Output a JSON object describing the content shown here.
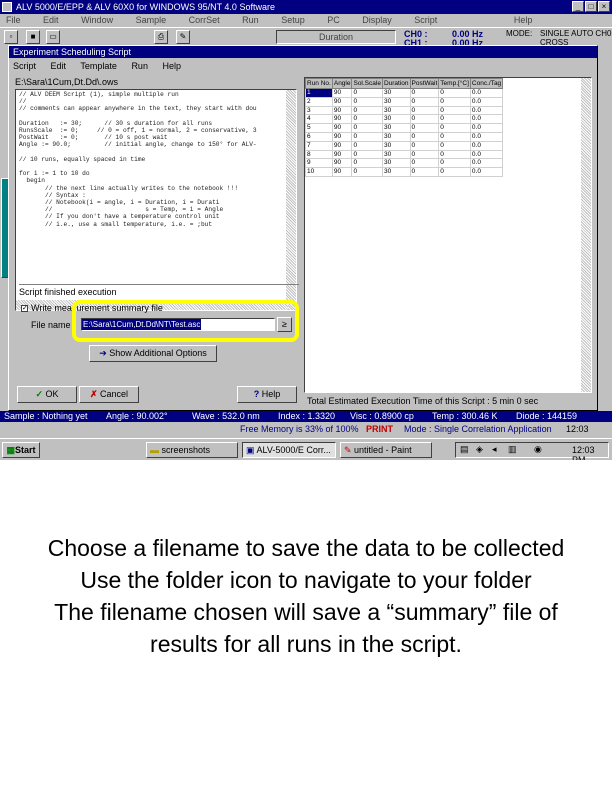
{
  "app": {
    "title": "ALV 5000/E/EPP & ALV 60X0 for WINDOWS 95/NT 4.0 Software",
    "menu": [
      "File",
      "Edit",
      "Window",
      "Sample",
      "CorrSet",
      "Run",
      "Setup",
      "PC",
      "Display",
      "Script",
      "Help"
    ],
    "duration_label": "Duration",
    "ch0_label": "CH0 :",
    "ch1_label": "CH1 :",
    "ch0_value": "0.00 Hz",
    "ch1_value": "0.00 Hz",
    "mode_label": "MODE:",
    "mode_value": "SINGLE AUTO CH0",
    "mode2_value": "CROSS"
  },
  "dialog": {
    "title": "Experiment Scheduling Script",
    "menu": [
      "Script",
      "Edit",
      "Template",
      "Run",
      "Help"
    ],
    "path": "E:\\Sara\\1Cum,Dt.Dd\\.ows",
    "code_lines": [
      "// ALV DEEM Script (1), simple multiple run",
      "//",
      "// comments can appear anywhere in the text, they start with dou",
      "",
      "Duration   := 30;      // 30 s duration for all runs",
      "RunsScale  := 0;     // 0 = off, 1 = normal, 2 = conservative, 3",
      "PostWait   := 0;       // 10 s post wait",
      "Angle := 90.0;         // initial angle, change to 150° for ALV-",
      "",
      "// 10 runs, equally spaced in time",
      "",
      "for i := 1 to 10 do",
      "  begin",
      "       // the next line actually writes to the notebook !!!",
      "       // Syntax :",
      "       // Notebook(i = angle, i = Duration, i = Durati",
      "       //                         s = Temp, = i = Angle",
      "       // If you don't have a temperature control unit",
      "       // i.e., use a small temperature, i.e. = ;but"
    ],
    "finished_label": "Script finished execution",
    "write_label": "Write measurement summary file",
    "write_checked": true,
    "filename_label": "File name :",
    "filename_value": "E:\\Sara\\1Cum,Dt.Dd\\NT\\Test.asc",
    "show_options_label": "Show Additional Options",
    "ok_label": "OK",
    "cancel_label": "Cancel",
    "help_label": "Help",
    "total_label": "Total Estimated Execution Time of this Script : 5 min 0 sec",
    "grid_headers": [
      "Run No.",
      "Angle",
      "Sol.Scale",
      "Duration",
      "PostWait",
      "Temp.[°C]",
      "Conc./Tag"
    ],
    "grid_rows": [
      [
        "1",
        "90",
        "0",
        "30",
        "0",
        "0",
        "0.0"
      ],
      [
        "2",
        "90",
        "0",
        "30",
        "0",
        "0",
        "0.0"
      ],
      [
        "3",
        "90",
        "0",
        "30",
        "0",
        "0",
        "0.0"
      ],
      [
        "4",
        "90",
        "0",
        "30",
        "0",
        "0",
        "0.0"
      ],
      [
        "5",
        "90",
        "0",
        "30",
        "0",
        "0",
        "0.0"
      ],
      [
        "6",
        "90",
        "0",
        "30",
        "0",
        "0",
        "0.0"
      ],
      [
        "7",
        "90",
        "0",
        "30",
        "0",
        "0",
        "0.0"
      ],
      [
        "8",
        "90",
        "0",
        "30",
        "0",
        "0",
        "0.0"
      ],
      [
        "9",
        "90",
        "0",
        "30",
        "0",
        "0",
        "0.0"
      ],
      [
        "10",
        "90",
        "0",
        "30",
        "0",
        "0",
        "0.0"
      ]
    ]
  },
  "status": {
    "sample": "Sample : Nothing yet",
    "angle": "Angle : 90.002°",
    "wave": "Wave : 532.0 nm",
    "index": "Index : 1.3320",
    "visc": "Visc : 0.8900 cp",
    "temp": "Temp : 300.46 K",
    "diode": "Diode : 144159",
    "memory": "Free Memory is 33% of 100%",
    "print_label": "PRINT",
    "mode_status": "Mode : Single Correlation Application",
    "time": "12:03"
  },
  "taskbar": {
    "start": "Start",
    "items": [
      "screenshots",
      "ALV-5000/E Corr...",
      "untitled - Paint"
    ],
    "clock": "12:03 PM"
  },
  "caption": [
    "Choose a filename to save the data to be collected",
    "Use the folder icon to navigate to your folder",
    "The filename chosen will save a “summary” file of",
    "results for all runs in the script."
  ]
}
